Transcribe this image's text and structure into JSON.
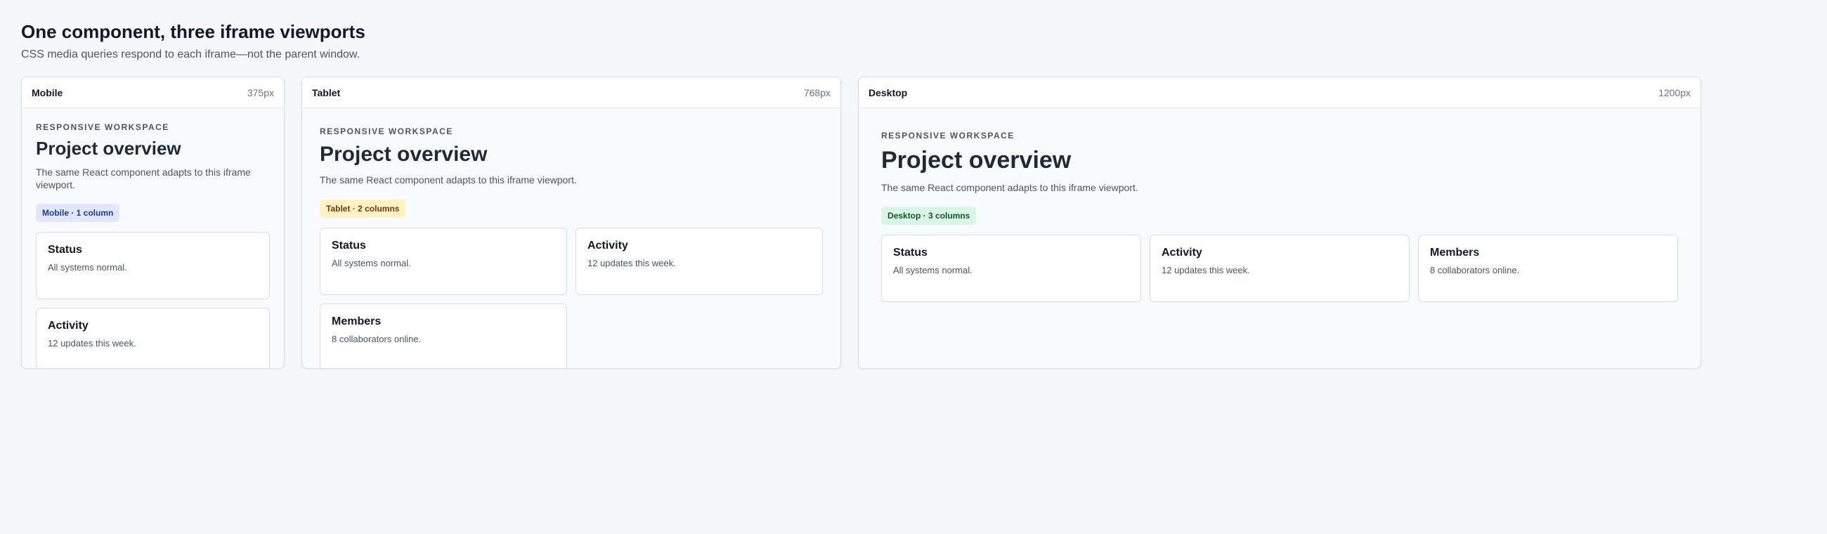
{
  "page": {
    "title": "One component, three iframe viewports",
    "subtitle": "CSS media queries respond to each iframe—not the parent window."
  },
  "frames": [
    {
      "name": "Mobile",
      "width_label": "375px",
      "eyebrow": "RESPONSIVE WORKSPACE",
      "heading": "Project overview",
      "description": "The same React component adapts to this iframe viewport.",
      "badge": "Mobile · 1 column",
      "badge_color": "#e0e7ff",
      "cards": [
        {
          "title": "Status",
          "text": "All systems normal."
        },
        {
          "title": "Activity",
          "text": "12 updates this week."
        }
      ]
    },
    {
      "name": "Tablet",
      "width_label": "768px",
      "eyebrow": "RESPONSIVE WORKSPACE",
      "heading": "Project overview",
      "description": "The same React component adapts to this iframe viewport.",
      "badge": "Tablet · 2 columns",
      "badge_color": "#fdf3c4",
      "cards": [
        {
          "title": "Status",
          "text": "All systems normal."
        },
        {
          "title": "Activity",
          "text": "12 updates this week."
        },
        {
          "title": "Members",
          "text": "8 collaborators online."
        }
      ]
    },
    {
      "name": "Desktop",
      "width_label": "1200px",
      "eyebrow": "RESPONSIVE WORKSPACE",
      "heading": "Project overview",
      "description": "The same React component adapts to this iframe viewport.",
      "badge": "Desktop · 3 columns",
      "badge_color": "#d9f5e3",
      "cards": [
        {
          "title": "Status",
          "text": "All systems normal."
        },
        {
          "title": "Activity",
          "text": "12 updates this week."
        },
        {
          "title": "Members",
          "text": "8 collaborators online."
        }
      ]
    }
  ]
}
